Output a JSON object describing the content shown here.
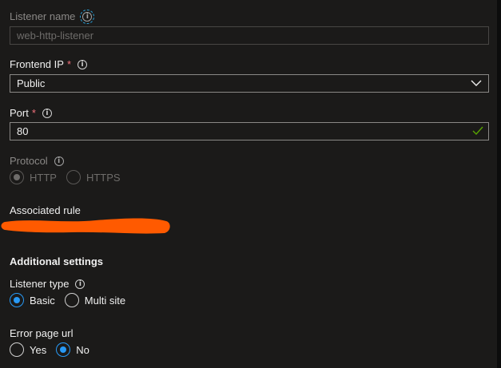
{
  "listener_name": {
    "label": "Listener name",
    "placeholder": "web-http-listener",
    "value": ""
  },
  "frontend_ip": {
    "label": "Frontend IP",
    "required": "*",
    "value": "Public"
  },
  "port": {
    "label": "Port",
    "required": "*",
    "value": "80"
  },
  "protocol": {
    "label": "Protocol",
    "options": [
      "HTTP",
      "HTTPS"
    ],
    "selected": "HTTP"
  },
  "associated_rule": {
    "label": "Associated rule"
  },
  "additional_settings": {
    "heading": "Additional settings"
  },
  "listener_type": {
    "label": "Listener type",
    "options": [
      "Basic",
      "Multi site"
    ],
    "selected": "Basic"
  },
  "error_page_url": {
    "label": "Error page url",
    "options": [
      "Yes",
      "No"
    ],
    "selected": "No"
  },
  "icons": {
    "info": "info-icon",
    "dropdown": "chevron-down-icon",
    "valid": "checkmark-icon"
  },
  "colors": {
    "background": "#1b1a19",
    "accent": "#2899f5",
    "required": "#f1707b",
    "valid": "#57a300",
    "redaction": "#ff5a00"
  }
}
